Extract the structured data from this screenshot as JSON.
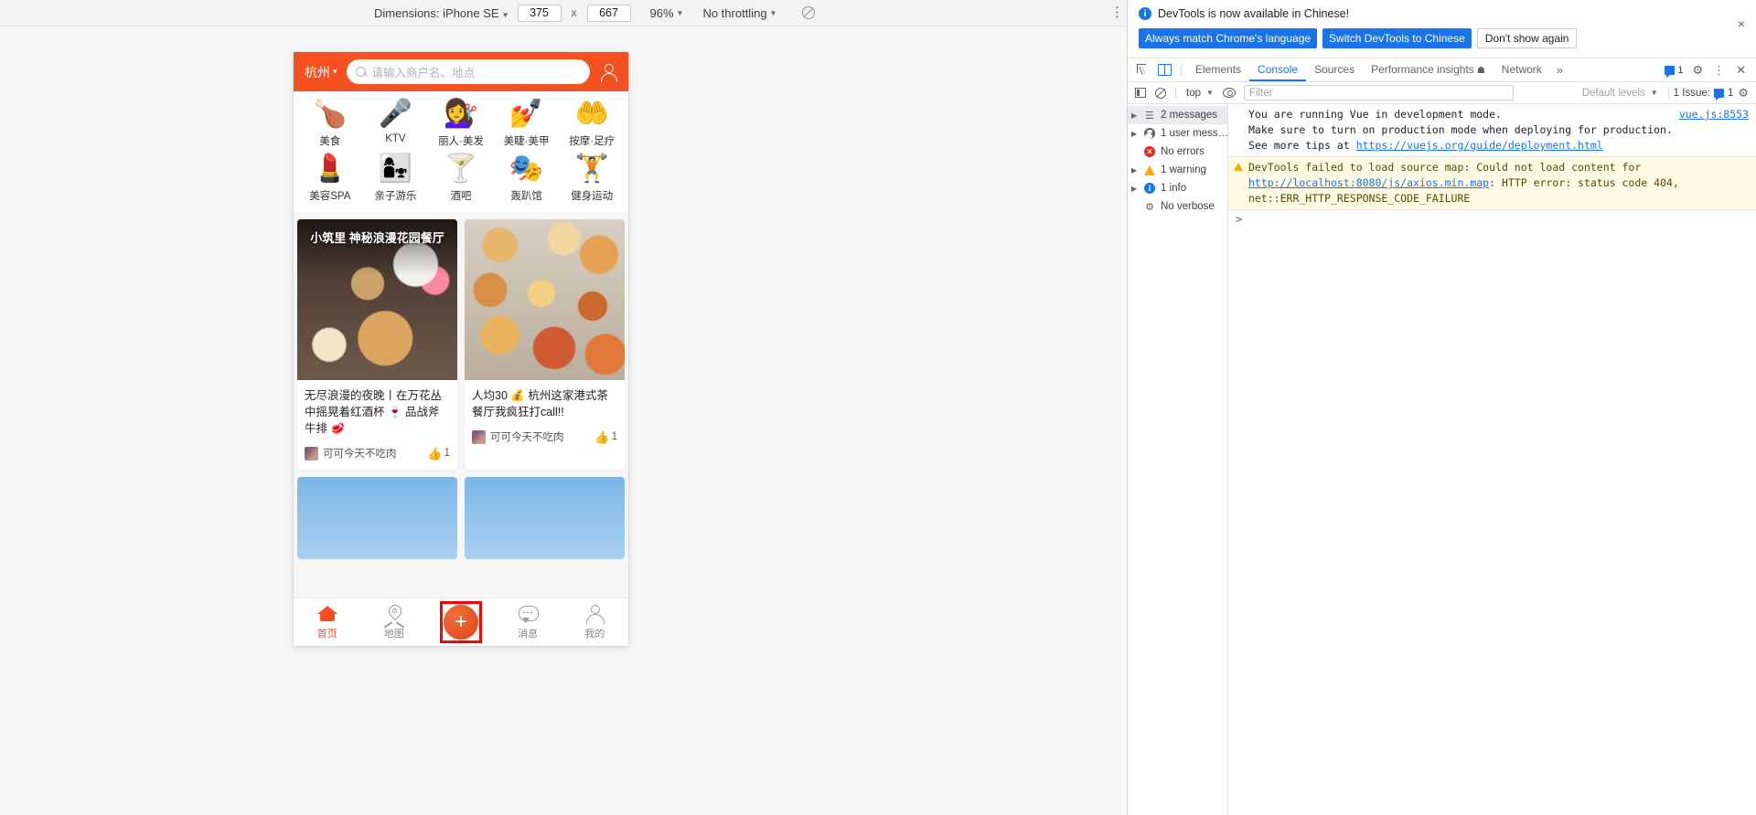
{
  "device_toolbar": {
    "dimensions_label": "Dimensions: iPhone SE",
    "width_value": "375",
    "x_separator": "x",
    "height_value": "667",
    "zoom_label": "96%",
    "throttling_label": "No throttling",
    "rotate_icon": "no-signal-icon",
    "kebab": "⋮"
  },
  "phone": {
    "header": {
      "city": "杭州",
      "city_chevron": "▾",
      "search_placeholder": "请输入商户名、地点",
      "search_icon": "search-icon",
      "user_icon": "user-icon"
    },
    "categories": [
      {
        "emoji": "🍗",
        "label": "美食"
      },
      {
        "emoji": "🎤",
        "label": "KTV"
      },
      {
        "emoji": "💇‍♀️",
        "label": "丽人·美发"
      },
      {
        "emoji": "💅",
        "label": "美睫·美甲"
      },
      {
        "emoji": "🤲",
        "label": "按摩·足疗"
      },
      {
        "emoji": "💄",
        "label": "美容SPA"
      },
      {
        "emoji": "👩‍👧",
        "label": "亲子游乐"
      },
      {
        "emoji": "🍸",
        "label": "酒吧"
      },
      {
        "emoji": "🎭",
        "label": "轰趴馆"
      },
      {
        "emoji": "🏋️",
        "label": "健身运动"
      }
    ],
    "feed": [
      {
        "image_overlay_title": "小筑里\n神秘浪漫花园餐厅",
        "title": "无尽浪漫的夜晚丨在万花丛中摇晃着红酒杯 🍷 品战斧牛排 🥩",
        "author": "可可今天不吃肉",
        "like_icon": "thumbs-up-icon",
        "likes": "1"
      },
      {
        "image_overlay_title": "",
        "title": "人均30 💰 杭州这家港式茶餐厅我疯狂打call!!",
        "author": "可可今天不吃肉",
        "like_icon": "thumbs-up-icon",
        "likes": "1"
      }
    ],
    "bottom_nav": [
      {
        "icon": "home-icon",
        "label": "首页",
        "active": true
      },
      {
        "icon": "map-pin-icon",
        "label": "地图",
        "active": false
      },
      {
        "icon": "plus-icon",
        "label": "+",
        "active": false
      },
      {
        "icon": "message-icon",
        "label": "消息",
        "active": false
      },
      {
        "icon": "profile-icon",
        "label": "我的",
        "active": false
      }
    ],
    "plus_button_glyph": "+"
  },
  "devtools": {
    "banner": {
      "info_icon": "info-icon",
      "message": "DevTools is now available in Chinese!",
      "primary_button": "Always match Chrome's language",
      "secondary_button": "Switch DevTools to Chinese",
      "tertiary_button": "Don't show again",
      "close_icon": "×",
      "accent_color": "#1a73e8"
    },
    "tabs": {
      "inspect_icon": "inspect-element-icon",
      "device_icon": "toggle-device-toolbar-icon",
      "items": [
        {
          "label": "Elements",
          "active": false
        },
        {
          "label": "Console",
          "active": true
        },
        {
          "label": "Sources",
          "active": false
        },
        {
          "label": "Performance insights",
          "active": false,
          "suffix": "☗"
        },
        {
          "label": "Network",
          "active": false
        }
      ],
      "overflow": "»",
      "issues_count": "1",
      "settings_icon": "gear-icon",
      "kebab_icon": "⋮",
      "close_icon": "✕"
    },
    "console_toolbar": {
      "sidebar_icon": "toggle-console-sidebar-icon",
      "clear_icon": "clear-console-icon",
      "context": "top",
      "eye_icon": "live-expression-icon",
      "filter_placeholder": "Filter",
      "filter_value": "",
      "levels_label": "Default levels",
      "issues_label": "1 Issue:",
      "issues_count": "1",
      "settings_icon": "gear-icon"
    },
    "sidebar": [
      {
        "icon": "list-icon",
        "label": "2 messages",
        "expandable": true,
        "selected": true
      },
      {
        "icon": "user-message-icon",
        "label": "1 user mess…",
        "expandable": true,
        "selected": false
      },
      {
        "icon": "error-icon",
        "label": "No errors",
        "expandable": false,
        "selected": false
      },
      {
        "icon": "warning-icon",
        "label": "1 warning",
        "expandable": true,
        "selected": false
      },
      {
        "icon": "info-icon",
        "label": "1 info",
        "expandable": true,
        "selected": false
      },
      {
        "icon": "verbose-icon",
        "label": "No verbose",
        "expandable": false,
        "selected": false
      }
    ],
    "messages": [
      {
        "type": "info",
        "source": "vue.js:8553",
        "lines": [
          "You are running Vue in development mode.",
          "Make sure to turn on production mode when deploying for production.",
          "See more tips at "
        ],
        "link": "https://vuejs.org/guide/deployment.html"
      },
      {
        "type": "warning",
        "warning_icon": "warning-triangle-icon",
        "text_before": "DevTools failed to load source map: Could not load content for ",
        "link": "http://localhost:8080/js/axios.min.map",
        "text_after": ": HTTP error: status code 404, net::ERR_HTTP_RESPONSE_CODE_FAILURE"
      }
    ],
    "prompt": ">"
  }
}
